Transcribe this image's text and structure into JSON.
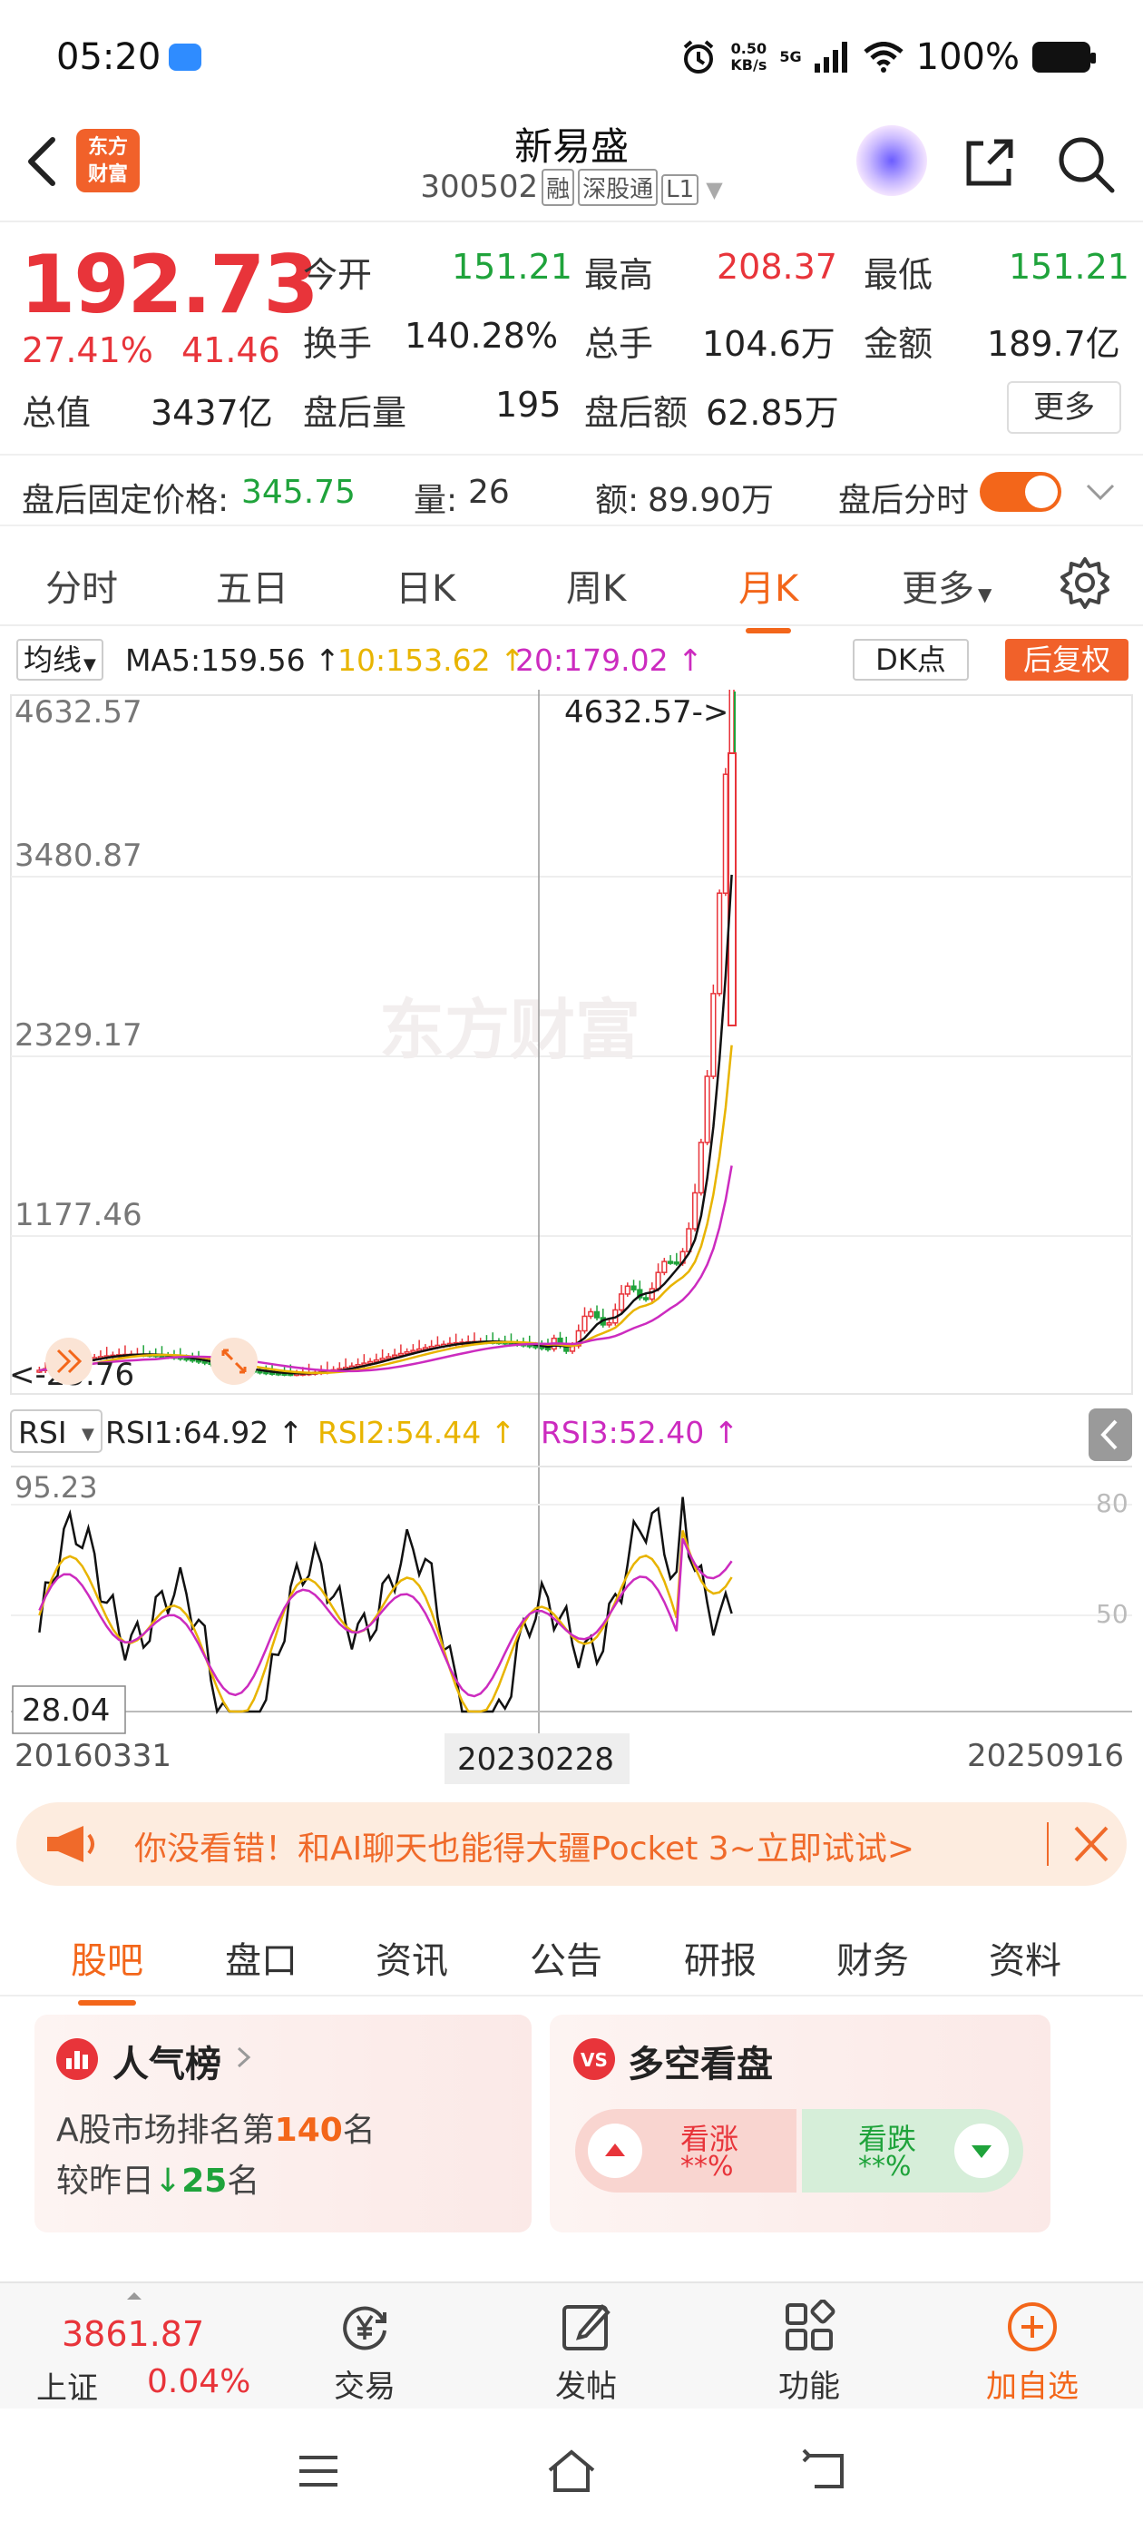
{
  "status_bar": {
    "time": "05:20",
    "net_speed_value": "0.50",
    "net_speed_unit": "KB/s",
    "network": "5G",
    "battery": "100%"
  },
  "header": {
    "logo_text_1": "东方",
    "logo_text_2": "财富",
    "title": "新易盛",
    "code": "300502",
    "tag_rong": "融",
    "tag_connect": "深股通",
    "tag_level": "L1"
  },
  "quote": {
    "price": "192.73",
    "change_pct": "27.41%",
    "change": "41.46",
    "open_label": "今开",
    "open": "151.21",
    "high_label": "最高",
    "high": "208.37",
    "low_label": "最低",
    "low": "151.21",
    "turnover_label": "换手",
    "turnover": "140.28%",
    "volume_label": "总手",
    "volume": "104.6万",
    "amount_label": "金额",
    "amount": "189.7亿",
    "mktcap_label": "总值",
    "mktcap": "3437亿",
    "ah_vol_label": "盘后量",
    "ah_vol": "195",
    "ah_amt_label": "盘后额",
    "ah_amt": "62.85万",
    "more": "更多"
  },
  "after_hours": {
    "fixed_price_label": "盘后固定价格:",
    "fixed_price": "345.75",
    "vol_label": "量:",
    "vol": "26",
    "amt_label": "额:",
    "amt": "89.90万",
    "switch_label": "盘后分时",
    "switch_on": true
  },
  "period_tabs": [
    {
      "label": "分时"
    },
    {
      "label": "五日"
    },
    {
      "label": "日K"
    },
    {
      "label": "周K"
    },
    {
      "label": "月K",
      "active": true
    },
    {
      "label": "更多"
    }
  ],
  "ma_bar": {
    "selector": "均线",
    "ma5": "MA5:159.56 ↑",
    "ma10": "10:153.62 ↑",
    "ma20": "20:179.02 ↑",
    "dk": "DK点",
    "adjust": "后复权"
  },
  "rsi_bar": {
    "selector": "RSI",
    "rsi1": "RSI1:64.92 ↑",
    "rsi2": "RSI2:54.44 ↑",
    "rsi3": "RSI3:52.40 ↑"
  },
  "chart_data": {
    "type": "candlestick",
    "price_axis_labels": [
      "4632.57",
      "3480.87",
      "2329.17",
      "1177.46",
      "25.76"
    ],
    "max_annotation": "4632.57->",
    "min_annotation": "<-25.76",
    "watermark": "东方财富",
    "rsi_axis_labels": [
      "95.23",
      "28.04"
    ],
    "rsi_ref_labels": [
      "80",
      "50"
    ],
    "x_labels": [
      "20160331",
      "20230228",
      "20250916"
    ],
    "cursor_date": "20230228",
    "colors": {
      "up": "#e8343a",
      "down": "#1fa33b",
      "ma5": "#111111",
      "ma10": "#e8b400",
      "ma20": "#cc2bbf"
    }
  },
  "ad": {
    "text": "你没看错！和AI聊天也能得大疆Pocket 3~立即试试>"
  },
  "section_tabs": [
    {
      "label": "股吧",
      "active": true
    },
    {
      "label": "盘口"
    },
    {
      "label": "资讯"
    },
    {
      "label": "公告"
    },
    {
      "label": "研报"
    },
    {
      "label": "财务"
    },
    {
      "label": "资料"
    }
  ],
  "rank_card": {
    "title": "人气榜",
    "line1_pre": "A股市场排名第",
    "line1_num": "140",
    "line1_post": "名",
    "line2_pre": "较昨日",
    "line2_num": "25",
    "line2_post": "名"
  },
  "vote_card": {
    "title": "多空看盘",
    "up_label": "看涨",
    "up_value": "**%",
    "down_label": "看跌",
    "down_value": "**%"
  },
  "bottom_nav": {
    "index_value": "3861.87",
    "index_name": "上证",
    "index_change": "0.04%",
    "trade": "交易",
    "post": "发帖",
    "functions": "功能",
    "add": "加自选"
  }
}
